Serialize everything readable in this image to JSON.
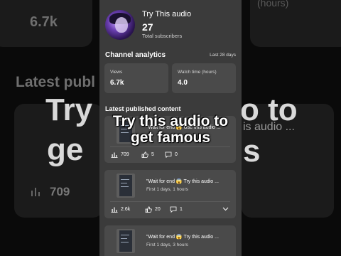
{
  "background": {
    "top_value": "6.7k",
    "heading_left": "Latest publ",
    "views_value": "709",
    "big_left": "Try th",
    "big_left2": "ge",
    "big_right": "o to",
    "big_right2": "is audio ...",
    "big_right3": "s",
    "top_right_caption": "(hours)"
  },
  "channel": {
    "name": "Try This audio",
    "subscribers": "27",
    "subscribers_label": "Total subscribers"
  },
  "analytics": {
    "title": "Channel analytics",
    "period": "Last 28 days",
    "views_label": "Views",
    "views_value": "6.7k",
    "watch_label": "Watch time (hours)",
    "watch_value": "4.0"
  },
  "latest": {
    "title": "Latest published content",
    "items": [
      {
        "title": "\"Wait for end 😱 Use this audio ...",
        "date": "",
        "views": "709",
        "likes": "5",
        "comments": "0"
      },
      {
        "title": "\"Wait for end 😱 Try this audio ...",
        "date": "First 1 days, 1 hours",
        "views": "2.6k",
        "likes": "20",
        "comments": "1"
      },
      {
        "title": "\"Wait for end 😱 Try this audio ...",
        "date": "First 1 days, 3 hours"
      }
    ]
  },
  "overlay": {
    "line1": "Try this audio to",
    "line2": "get famous"
  },
  "icons": {
    "views": "bar-chart-icon",
    "likes": "thumbs-up-icon",
    "comments": "comment-icon",
    "expand": "chevron-down-icon"
  }
}
